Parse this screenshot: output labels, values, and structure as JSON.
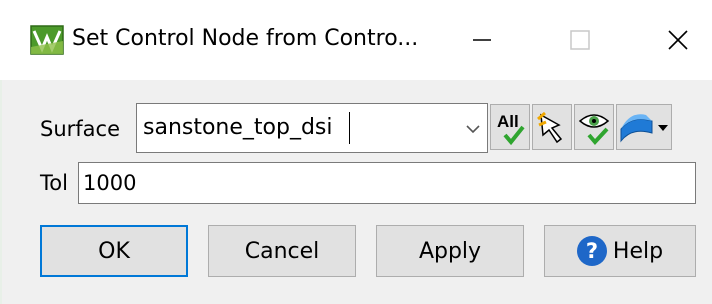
{
  "window": {
    "title": "Set Control Node from Contro...",
    "controls": {
      "minimize": "minimize",
      "maximize": "maximize",
      "close": "close"
    }
  },
  "surface": {
    "label": "Surface",
    "value": "sanstone_top_dsi"
  },
  "toolbar": {
    "all_label": "All",
    "icons": [
      "all-check-icon",
      "pick-arrow-icon",
      "eye-check-icon",
      "surface-dropdown-icon"
    ]
  },
  "tol": {
    "label": "Tol",
    "value": "1000"
  },
  "buttons": {
    "ok": "OK",
    "cancel": "Cancel",
    "apply": "Apply",
    "help": "Help"
  },
  "colors": {
    "focus": "#0078d7",
    "help_icon": "#1e67c8",
    "check_green": "#2fa52f",
    "app_icon_green": "#4c9a2a"
  }
}
